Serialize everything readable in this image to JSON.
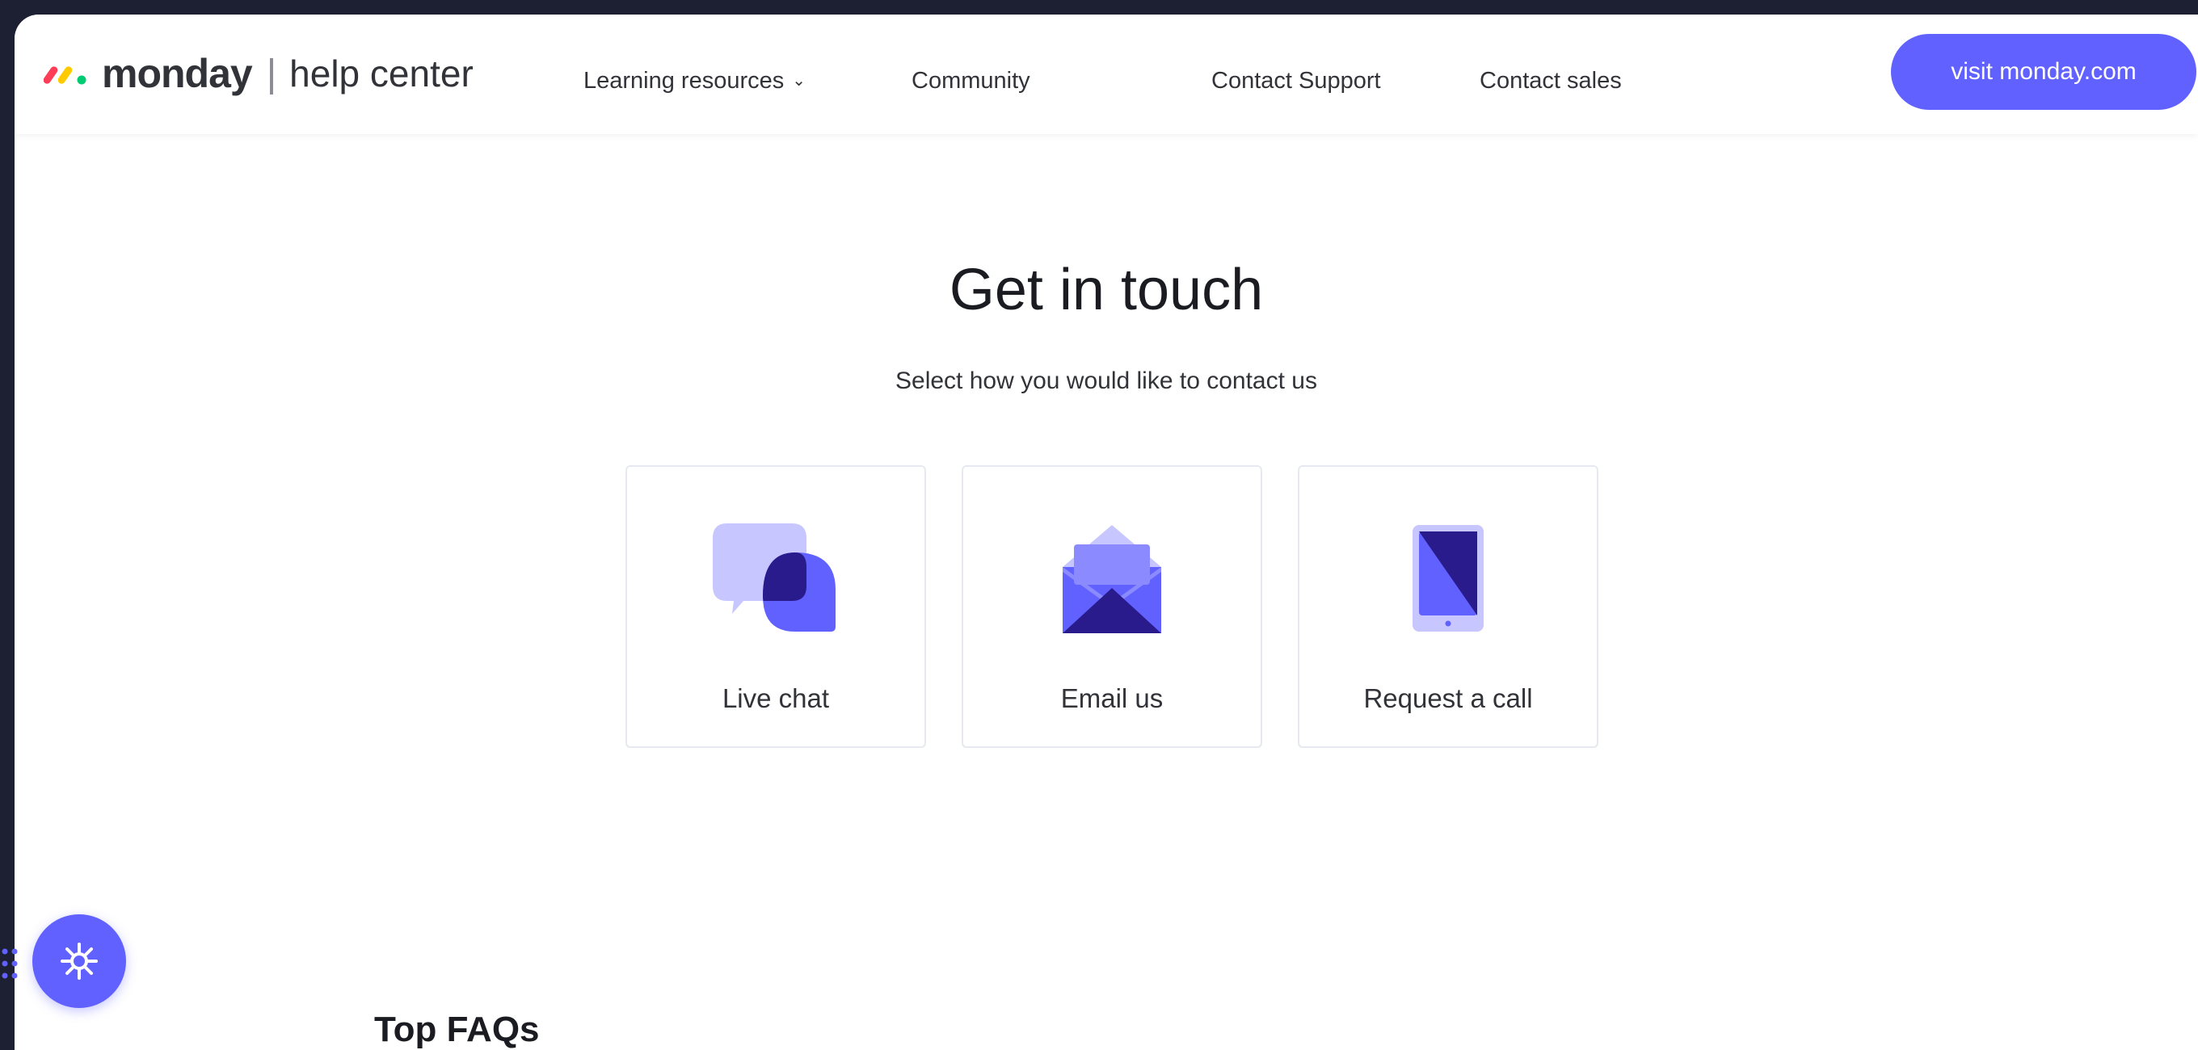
{
  "header": {
    "logo_word": "monday",
    "logo_separator": "|",
    "logo_sub": "help center",
    "nav": [
      {
        "label": "Learning resources",
        "has_dropdown": true,
        "icon": "chevron-down-icon"
      },
      {
        "label": "Community"
      },
      {
        "label": "Contact Support"
      },
      {
        "label": "Contact sales"
      }
    ],
    "cta_label": "visit monday.com"
  },
  "hero": {
    "title": "Get in touch",
    "subtitle": "Select how you would like to contact us"
  },
  "cards": [
    {
      "label": "Live chat",
      "icon": "chat-bubbles-icon"
    },
    {
      "label": "Email us",
      "icon": "envelope-icon"
    },
    {
      "label": "Request a call",
      "icon": "tablet-phone-icon"
    }
  ],
  "faq": {
    "title": "Top FAQs"
  },
  "assistant": {
    "icon": "sparkle-icon"
  },
  "colors": {
    "brand": "#6161ff",
    "brand_light": "#c7c6ff",
    "brand_dark": "#2a1b8c",
    "text": "#323338",
    "background_outer": "#1d1f33"
  }
}
